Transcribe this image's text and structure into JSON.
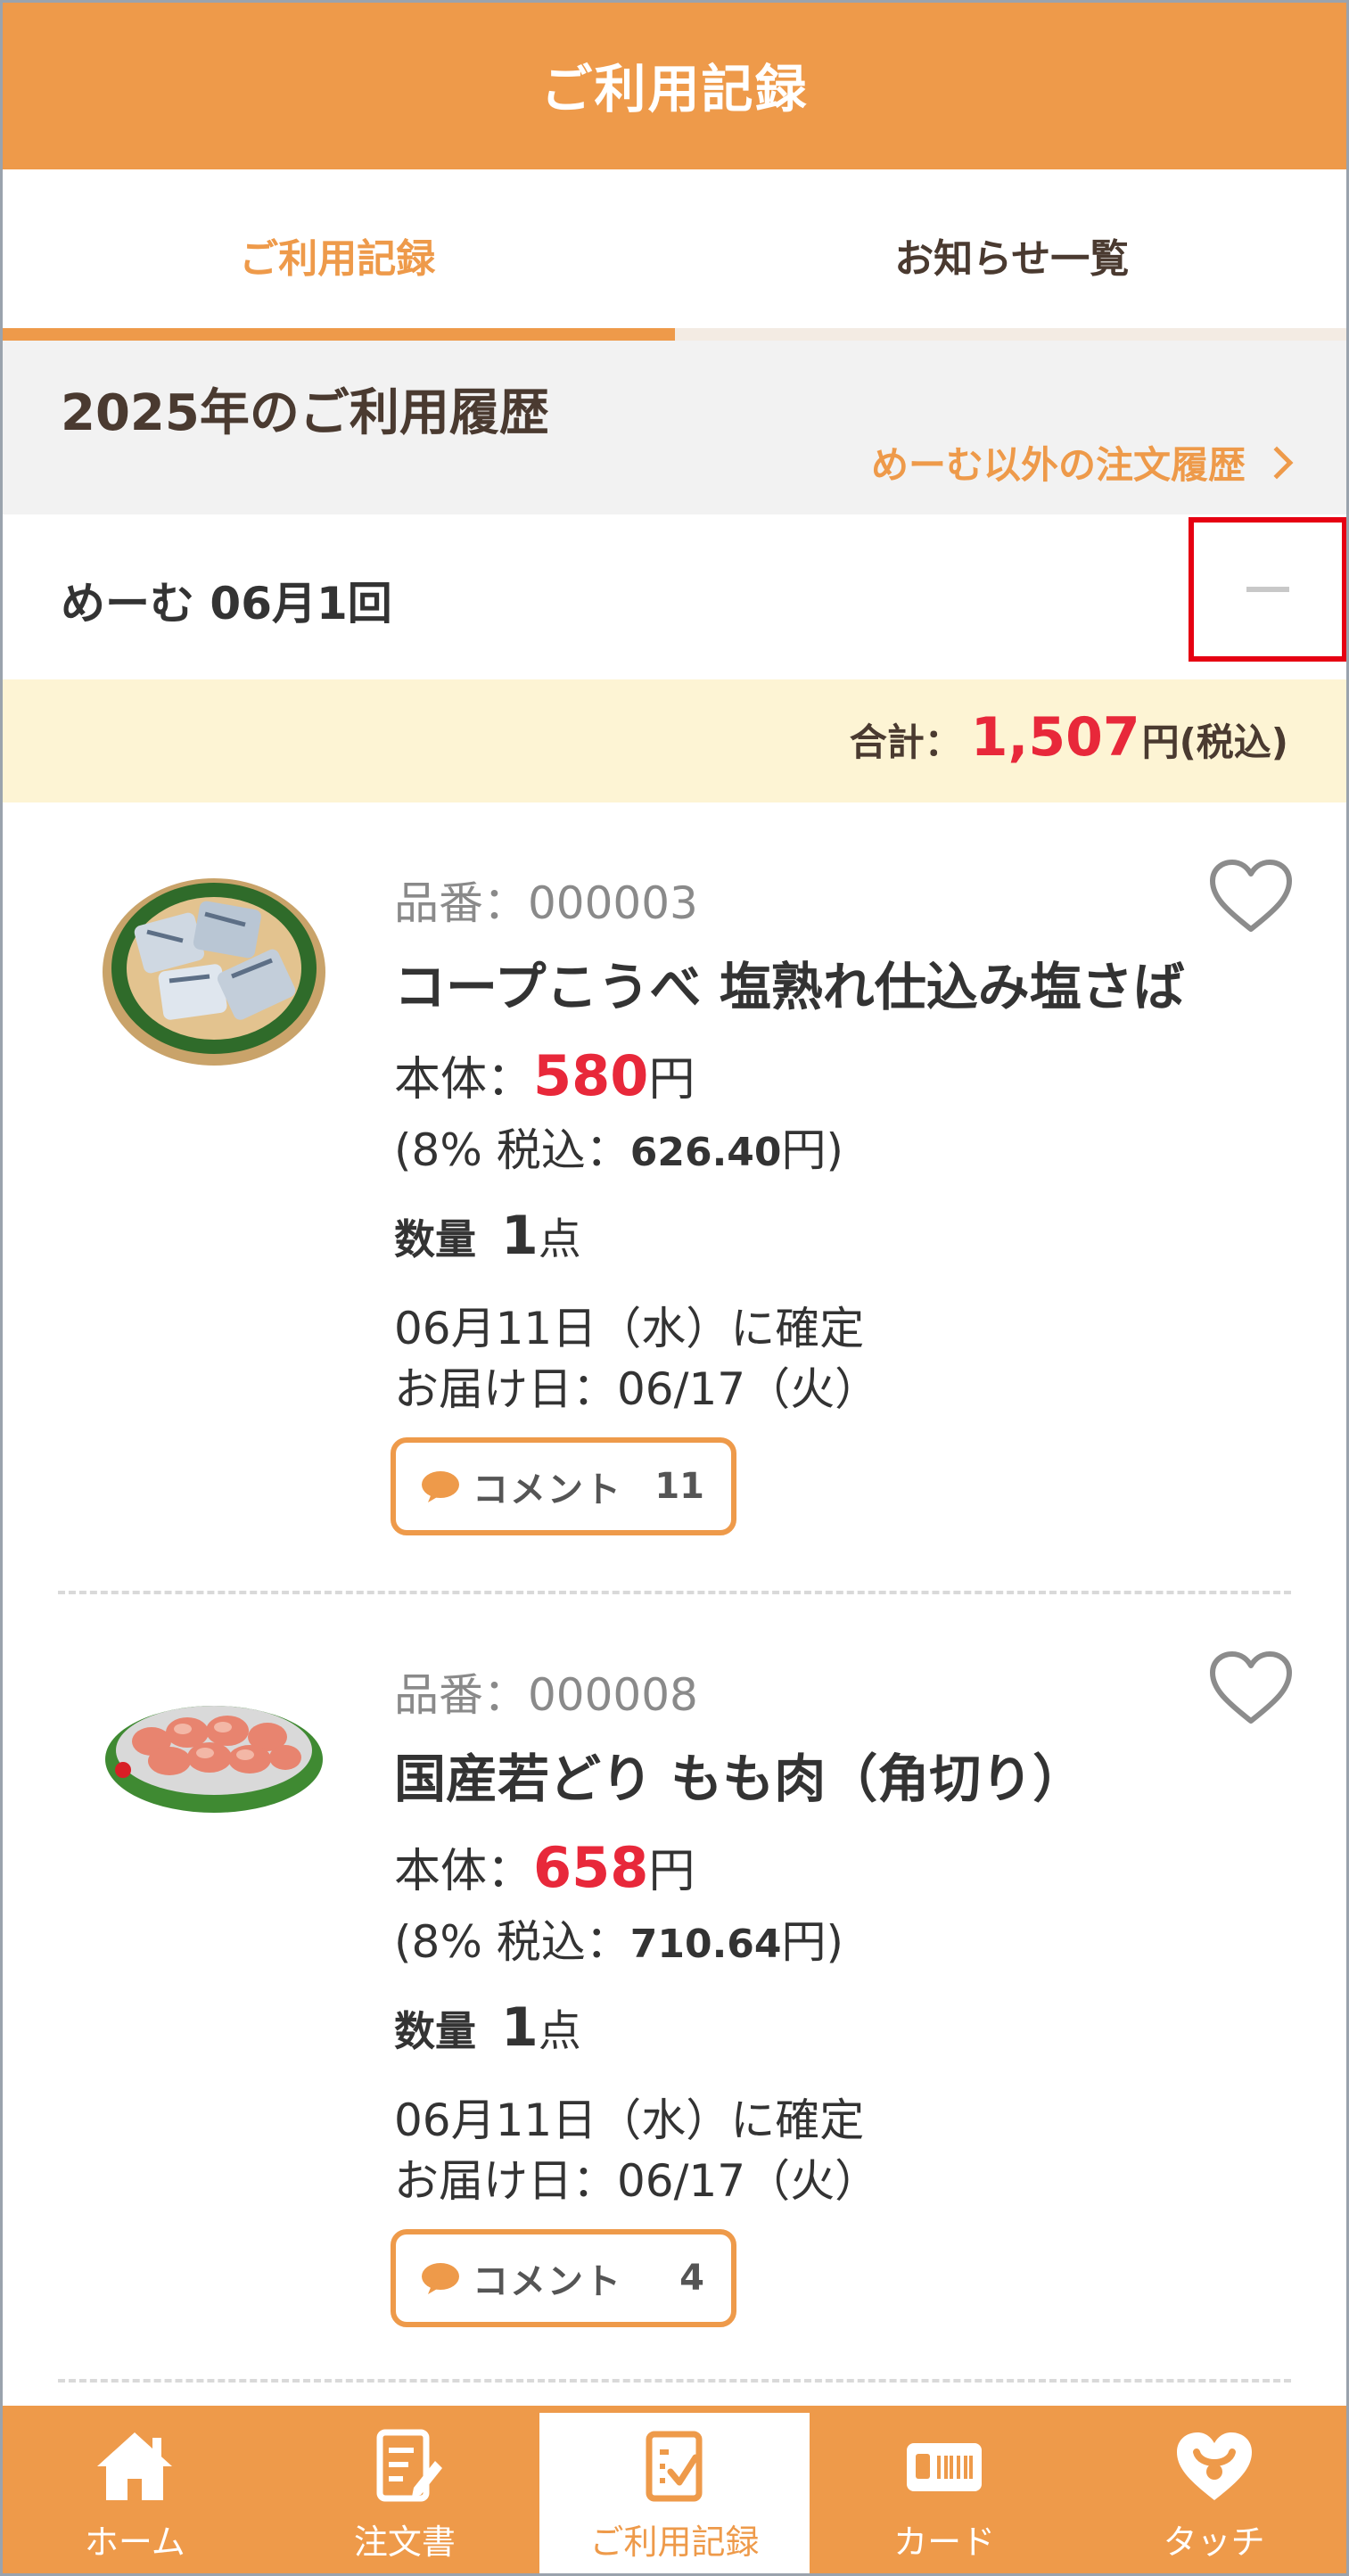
{
  "header": {
    "title": "ご利用記録"
  },
  "tabs": [
    {
      "label": "ご利用記録",
      "active": true
    },
    {
      "label": "お知らせ一覧",
      "active": false
    }
  ],
  "history": {
    "year_title": "2025年のご利用履歴",
    "other_link": "めーむ以外の注文履歴"
  },
  "group": {
    "title": "めーむ 06月1回"
  },
  "total": {
    "label": "合計：",
    "amount": "1,507",
    "yen": "円",
    "tax": "(税込)"
  },
  "items": [
    {
      "product_no": "品番：000003",
      "name": "コープこうべ 塩熟れ仕込み塩さば",
      "price_label": "本体：",
      "price": "580",
      "price_unit": "円",
      "tax_prefix": "(8% 税込：",
      "tax_value": "626.40",
      "tax_suffix": "円)",
      "qty_label": "数量",
      "qty": "1",
      "qty_unit": "点",
      "confirm": "06月11日（水）に確定",
      "delivery": "お届け日：06/17（火）",
      "comment_label": "コメント",
      "comment_count": "11"
    },
    {
      "product_no": "品番：000008",
      "name": "国産若どり もも肉（角切り）",
      "price_label": "本体：",
      "price": "658",
      "price_unit": "円",
      "tax_prefix": "(8% 税込：",
      "tax_value": "710.64",
      "tax_suffix": "円)",
      "qty_label": "数量",
      "qty": "1",
      "qty_unit": "点",
      "confirm": "06月11日（水）に確定",
      "delivery": "お届け日：06/17（火）",
      "comment_label": "コメント",
      "comment_count": "4"
    }
  ],
  "nav": [
    {
      "label": "ホーム",
      "icon": "home-icon"
    },
    {
      "label": "注文書",
      "icon": "order-form-icon"
    },
    {
      "label": "ご利用記録",
      "icon": "usage-record-icon",
      "active": true
    },
    {
      "label": "カード",
      "icon": "card-icon"
    },
    {
      "label": "タッチ",
      "icon": "touch-icon"
    }
  ],
  "colors": {
    "accent": "#ee9a4a",
    "price_red": "#e8283a",
    "highlight_border": "#e60012",
    "total_bg": "#fdf4d4"
  }
}
